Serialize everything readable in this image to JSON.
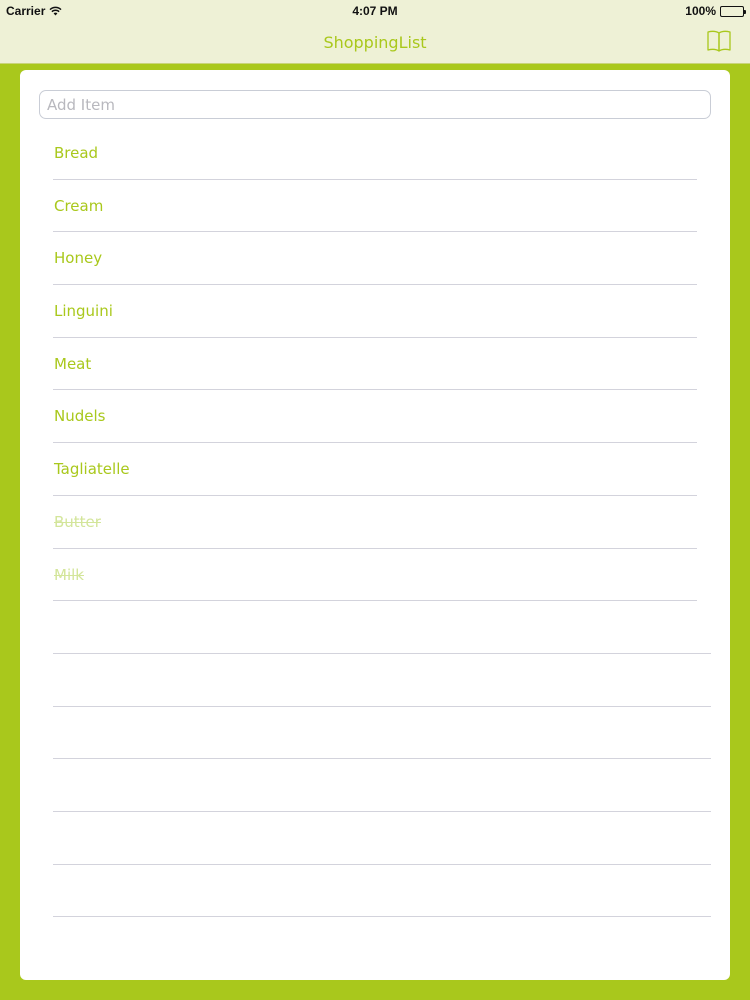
{
  "status_bar": {
    "carrier": "Carrier",
    "time": "4:07 PM",
    "battery": "100%"
  },
  "nav": {
    "title": "ShoppingList",
    "right_icon": "book-icon"
  },
  "add_item": {
    "placeholder": "Add Item",
    "value": ""
  },
  "items": [
    {
      "label": "Bread",
      "done": false
    },
    {
      "label": "Cream",
      "done": false
    },
    {
      "label": "Honey",
      "done": false
    },
    {
      "label": "Linguini",
      "done": false
    },
    {
      "label": "Meat",
      "done": false
    },
    {
      "label": "Nudels",
      "done": false
    },
    {
      "label": "Tagliatelle",
      "done": false
    },
    {
      "label": "Butter",
      "done": true
    },
    {
      "label": "Milk",
      "done": true
    }
  ],
  "colors": {
    "accent": "#a9c81c",
    "accent_done": "#d3e59a",
    "bar_background": "#eef1d6"
  }
}
